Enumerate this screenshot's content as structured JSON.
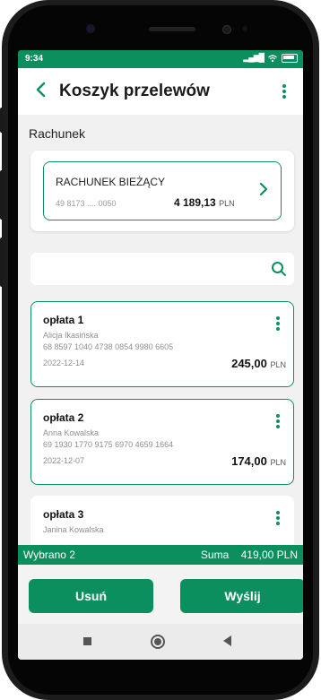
{
  "status": {
    "time": "9:34"
  },
  "header": {
    "title": "Koszyk przelewów"
  },
  "account": {
    "section_label": "Rachunek",
    "name": "RACHUNEK BIEŻĄCY",
    "number": "49 8173 .... 0050",
    "balance": "4 189,13",
    "currency": "PLN"
  },
  "search": {
    "value": "",
    "placeholder": ""
  },
  "transfers": [
    {
      "title": "opłata 1",
      "recipient": "Alicja Ikasińska",
      "account": "68 8597 1040 4738 0854 9980 6605",
      "date": "2022-12-14",
      "amount": "245,00",
      "currency": "PLN",
      "selected": true
    },
    {
      "title": "opłata 2",
      "recipient": "Anna Kowalska",
      "account": "69 1930 1770 9175 6970 4659 1664",
      "date": "2022-12-07",
      "amount": "174,00",
      "currency": "PLN",
      "selected": true
    },
    {
      "title": "opłata 3",
      "recipient": "Janina Kowalska",
      "account": "",
      "date": "",
      "amount": "",
      "currency": "",
      "selected": false
    }
  ],
  "summary": {
    "selected_label": "Wybrano 2",
    "sum_label": "Suma",
    "sum_value": "419,00 PLN"
  },
  "actions": {
    "delete_label": "Usuń",
    "send_label": "Wyślij"
  },
  "colors": {
    "accent": "#0c8f5f",
    "background": "#f1f1f1"
  },
  "icons": {
    "back": "back-arrow-icon",
    "menu": "more-vertical-icon",
    "account_arrow": "chevron-right-icon",
    "search": "search-icon",
    "nav_home": "home-circle-icon",
    "nav_recent": "recent-apps-icon",
    "nav_back": "nav-back-icon"
  }
}
